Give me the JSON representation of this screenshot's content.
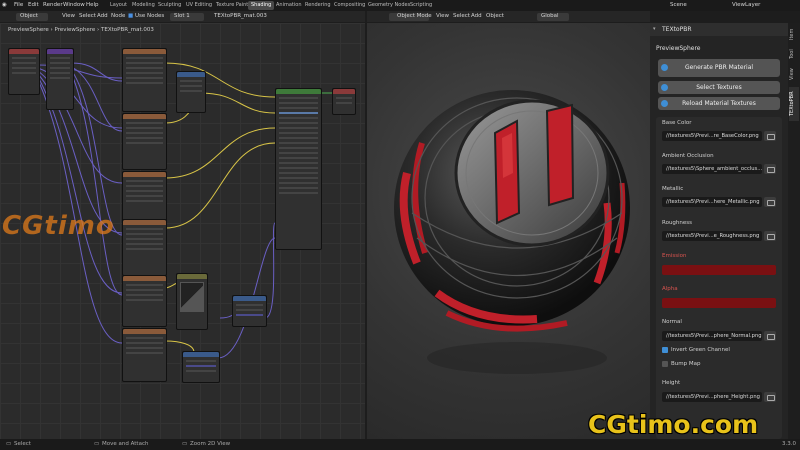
{
  "topbar": {
    "menus": [
      "File",
      "Edit",
      "Render",
      "Window",
      "Help"
    ],
    "workspaces": [
      "Layout",
      "Modeling",
      "Sculpting",
      "UV Editing",
      "Texture Paint",
      "Shading",
      "Animation",
      "Rendering",
      "Compositing",
      "Geometry Nodes",
      "Scripting"
    ],
    "active_workspace": "Shading",
    "scene": "Scene",
    "view_layer": "ViewLayer"
  },
  "node_header": {
    "mode": "Object",
    "menus": [
      "View",
      "Select",
      "Add",
      "Node"
    ],
    "use_nodes": "Use Nodes",
    "slot": "Slot 1",
    "material": "TEXtoPBR_mat.003"
  },
  "node_breadcrumb": {
    "object": "PreviewSphere",
    "mesh": "PreviewSphere",
    "material": "TEXtoPBR_mat.003"
  },
  "viewport_header": {
    "mode": "Object Mode",
    "menus": [
      "View",
      "Select",
      "Add",
      "Object"
    ],
    "transform": "Global"
  },
  "panel": {
    "title": "TEXtoPBR",
    "object_name": "PreviewSphere",
    "generate_button": "Generate PBR Material",
    "select_button": "Select Textures",
    "reload_button": "Reload Material Textures",
    "tabs": [
      "Item",
      "Tool",
      "View",
      "TEXtoPBR"
    ],
    "active_tab": "TEXtoPBR",
    "maps": [
      {
        "label": "Base Color",
        "path": "//textures5\\Previ...re_BaseColor.png"
      },
      {
        "label": "Ambient Occlusion",
        "path": "//textures5\\Sphere_ambient_occlus..."
      },
      {
        "label": "Metallic",
        "path": "//textures5\\Previ...here_Metallic.png"
      },
      {
        "label": "Roughness",
        "path": "//textures5\\Previ...e_Roughness.png"
      },
      {
        "label": "Emission",
        "color": "#7a1012"
      },
      {
        "label": "Alpha",
        "color": "#7a1012"
      },
      {
        "label": "Normal",
        "path": "//textures5\\Previ...phere_Normal.png"
      },
      {
        "label": "Height",
        "path": "//textures5\\Previ...phere_Height.png"
      }
    ],
    "invert_green": "Invert Green Channel",
    "invert_green_checked": true,
    "bump_map": "Bump Map",
    "bump_map_checked": false,
    "emission_label_color": "#d9534f"
  },
  "statusbar": {
    "select": "Select",
    "move": "Move and Attach",
    "zoom": "Zoom 2D View",
    "version": "3.3.0"
  },
  "watermark": {
    "left": "CGtimo",
    "right": "CGtimo.com"
  },
  "colors": {
    "accent_blue": "#3f8fd6",
    "watermark_yellow": "#e8c21a",
    "watermark_orange": "#e07a1a",
    "node_header_blue": "#3a5a8a",
    "node_header_green": "#3e7a3a",
    "node_header_red": "#8a3a3a",
    "node_header_tan": "#6a5a3a"
  }
}
